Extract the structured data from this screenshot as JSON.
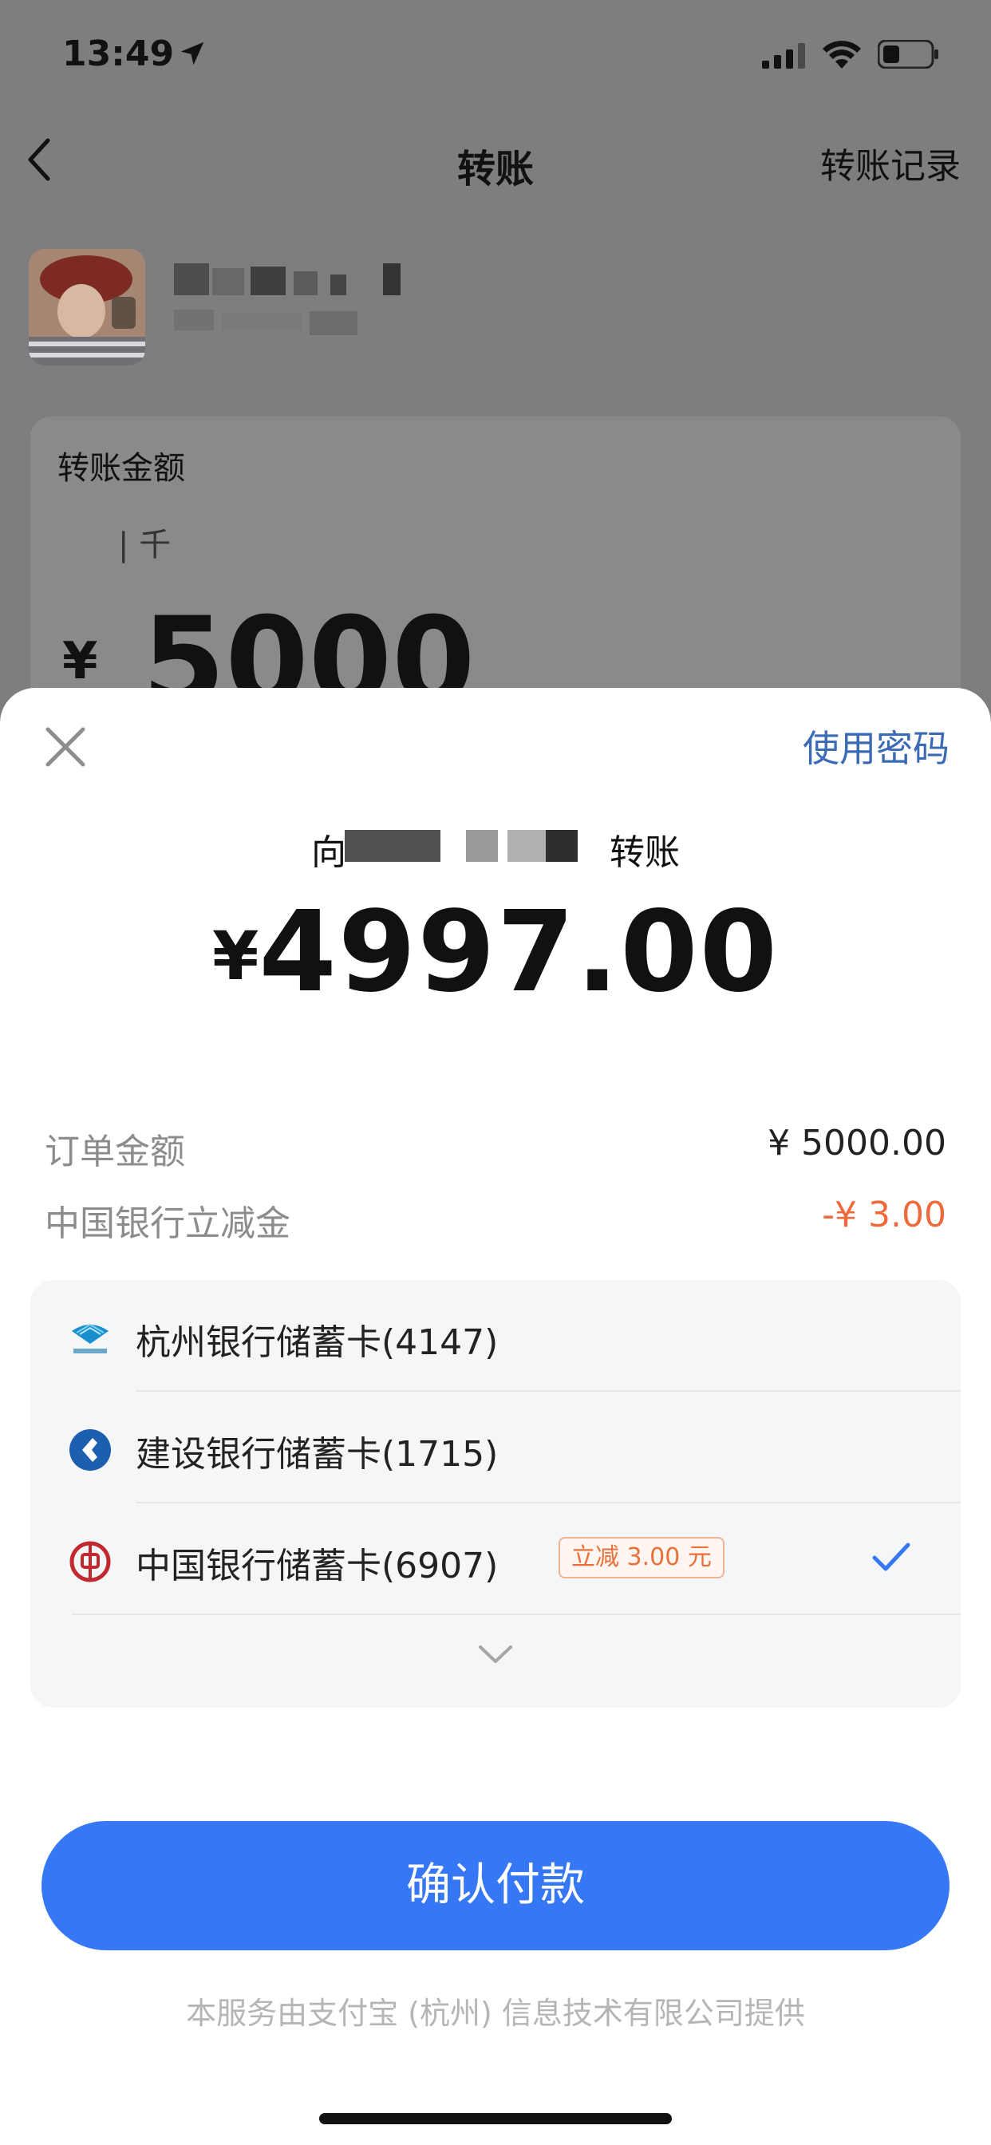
{
  "status_bar": {
    "time": "13:49"
  },
  "nav": {
    "title": "转账",
    "right_label": "转账记录"
  },
  "amount_card": {
    "label": "转账金额",
    "unit_hint": "| 千",
    "currency": "¥",
    "value": "5000"
  },
  "sheet": {
    "use_password": "使用密码",
    "transfer_to_prefix": "向",
    "transfer_to_suffix": "转账",
    "currency": "¥",
    "amount": "4997.00",
    "order_amount_label": "订单金额",
    "order_amount_value": "¥ 5000.00",
    "discount_label": "中国银行立减金",
    "discount_value": "-¥ 3.00",
    "cards": [
      {
        "label": "杭州银行储蓄卡(4147)",
        "icon": "hangzhou-bank-icon"
      },
      {
        "label": "建设银行储蓄卡(1715)",
        "icon": "ccb-icon"
      },
      {
        "label": "中国银行储蓄卡(6907)",
        "icon": "boc-icon",
        "promo": "立减 3.00 元",
        "selected": true
      }
    ],
    "confirm_label": "确认付款",
    "footer": "本服务由支付宝 (杭州) 信息技术有限公司提供"
  },
  "colors": {
    "accent": "#3677f6",
    "link": "#3b6bb5",
    "discount": "#ee6a3a"
  }
}
